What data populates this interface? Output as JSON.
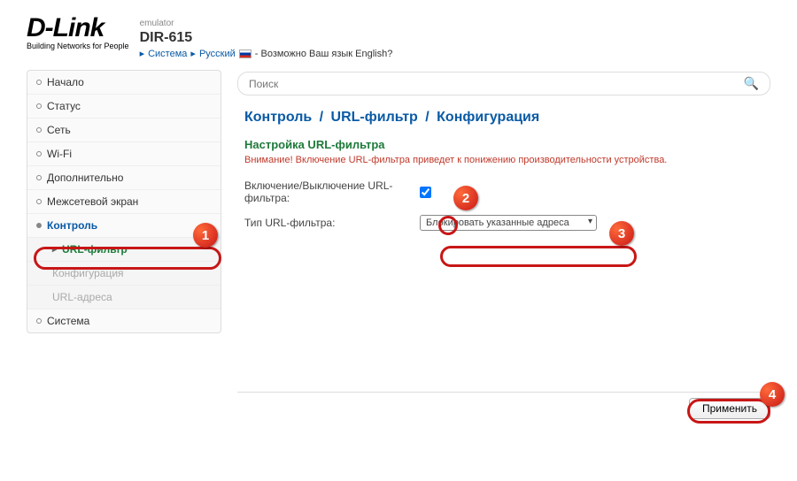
{
  "header": {
    "logo": "D-Link",
    "tagline": "Building Networks for People",
    "emulator": "emulator",
    "model": "DIR-615",
    "lang_system": "Система",
    "lang_current": "Русский",
    "lang_question": "- Возможно Ваш язык English?"
  },
  "search": {
    "placeholder": "Поиск"
  },
  "sidebar": {
    "items": [
      {
        "label": "Начало"
      },
      {
        "label": "Статус"
      },
      {
        "label": "Сеть"
      },
      {
        "label": "Wi-Fi"
      },
      {
        "label": "Дополнительно"
      },
      {
        "label": "Межсетевой экран"
      },
      {
        "label": "Контроль"
      },
      {
        "label": "URL-фильтр"
      },
      {
        "label": "Конфигурация"
      },
      {
        "label": "URL-адреса"
      },
      {
        "label": "Система"
      }
    ]
  },
  "breadcrumb": {
    "a": "Контроль",
    "b": "URL-фильтр",
    "c": "Конфигурация"
  },
  "section": {
    "title": "Настройка URL-фильтра",
    "warning": "Внимание! Включение URL-фильтра приведет к понижению производительности устройства."
  },
  "form": {
    "enable_label": "Включение/Выключение URL-фильтра:",
    "enable_checked": true,
    "type_label": "Тип URL-фильтра:",
    "type_value": "Блокировать указанные адреса"
  },
  "footer": {
    "apply": "Применить"
  },
  "annotations": {
    "n1": "1",
    "n2": "2",
    "n3": "3",
    "n4": "4"
  }
}
